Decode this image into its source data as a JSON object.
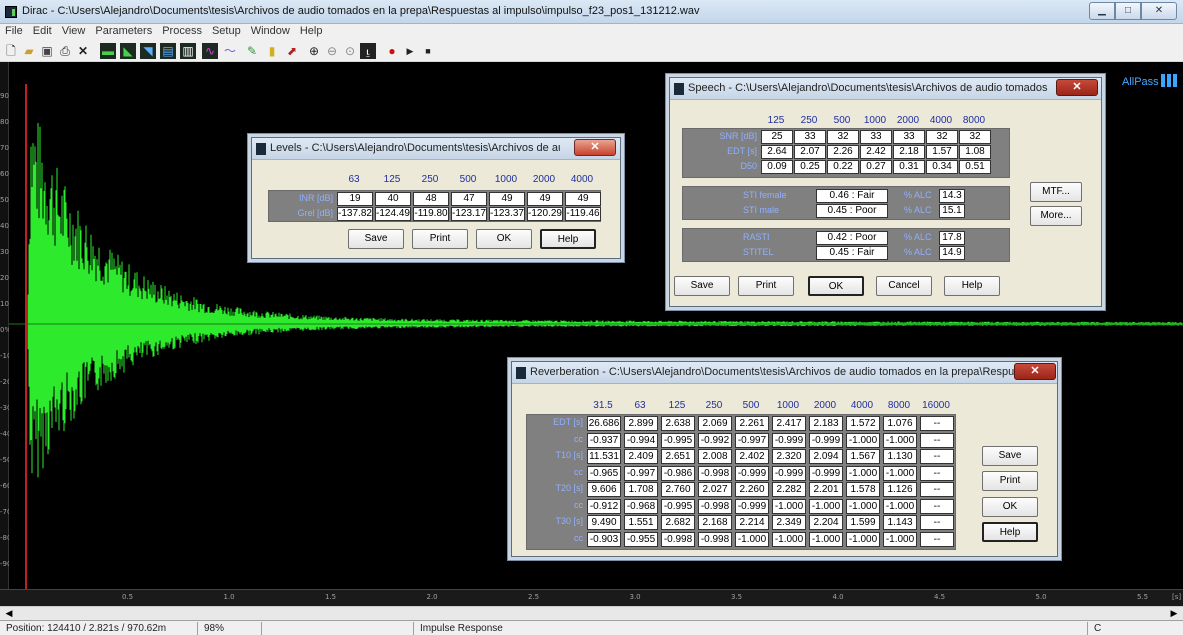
{
  "window": {
    "title": "Dirac - C:\\Users\\Alejandro\\Documents\\tesis\\Archivos de audio tomados en la prepa\\Respuestas al impulso\\impulso_f23_pos1_131212.wav",
    "btn_min": "▁",
    "btn_max": "□",
    "btn_close": "✕"
  },
  "menu": [
    "File",
    "Edit",
    "View",
    "Parameters",
    "Process",
    "Setup",
    "Window",
    "Help"
  ],
  "plot": {
    "y_ticks": [
      "90",
      "80",
      "70",
      "60",
      "50",
      "40",
      "30",
      "20",
      "10",
      "0%",
      "-10",
      "-20",
      "-30",
      "-40",
      "-50",
      "-60",
      "-70",
      "-80",
      "-90"
    ],
    "x_ticks": [
      "0.5",
      "1.0",
      "1.5",
      "2.0",
      "2.5",
      "3.0",
      "3.5",
      "4.0",
      "4.5",
      "5.0",
      "5.5"
    ],
    "x_unit": "[s]",
    "wave_color": "#2dea2d",
    "allpass": "AllPass"
  },
  "levels": {
    "title": "Levels - C:\\Users\\Alejandro\\Documents\\tesis\\Archivos de audio ...",
    "headers": [
      "63",
      "125",
      "250",
      "500",
      "1000",
      "2000",
      "4000"
    ],
    "rows": [
      {
        "label": "INR [dB]",
        "values": [
          "19",
          "40",
          "48",
          "47",
          "49",
          "49",
          "49"
        ]
      },
      {
        "label": "Grel [dB]",
        "values": [
          "-137.82",
          "-124.49",
          "-119.80",
          "-123.17",
          "-123.37",
          "-120.29",
          "-119.46"
        ]
      }
    ],
    "buttons": [
      "Save",
      "Print",
      "OK",
      "Help"
    ]
  },
  "speech": {
    "title": "Speech - C:\\Users\\Alejandro\\Documents\\tesis\\Archivos de audio tomados en l...",
    "headers": [
      "125",
      "250",
      "500",
      "1000",
      "2000",
      "4000",
      "8000"
    ],
    "rows": [
      {
        "label": "SNR [dB]",
        "values": [
          "25",
          "33",
          "32",
          "33",
          "33",
          "32",
          "32"
        ]
      },
      {
        "label": "EDT [s]",
        "values": [
          "2.64",
          "2.07",
          "2.26",
          "2.42",
          "2.18",
          "1.57",
          "1.08"
        ]
      },
      {
        "label": "D50",
        "values": [
          "0.09",
          "0.25",
          "0.22",
          "0.27",
          "0.31",
          "0.34",
          "0.51"
        ]
      }
    ],
    "sti": [
      {
        "label": "STI female",
        "value": "0.46 : Fair",
        "alc_label": "% ALC",
        "alc": "14.3"
      },
      {
        "label": "STI male",
        "value": "0.45 : Poor",
        "alc_label": "% ALC",
        "alc": "15.1"
      }
    ],
    "rasti": [
      {
        "label": "RASTI",
        "value": "0.42 : Poor",
        "alc_label": "% ALC",
        "alc": "17.8"
      },
      {
        "label": "STITEL",
        "value": "0.45 : Fair",
        "alc_label": "% ALC",
        "alc": "14.9"
      }
    ],
    "side_buttons": [
      "MTF...",
      "More..."
    ],
    "buttons": [
      "Save",
      "Print",
      "OK",
      "Cancel",
      "Help"
    ]
  },
  "reverb": {
    "title": "Reverberation - C:\\Users\\Alejandro\\Documents\\tesis\\Archivos de audio tomados en la prepa\\Respuest...",
    "headers": [
      "31.5",
      "63",
      "125",
      "250",
      "500",
      "1000",
      "2000",
      "4000",
      "8000",
      "16000"
    ],
    "rows": [
      {
        "label": "EDT [s]",
        "values": [
          "26.686",
          "2.899",
          "2.638",
          "2.069",
          "2.261",
          "2.417",
          "2.183",
          "1.572",
          "1.076",
          "--"
        ]
      },
      {
        "label": "cc",
        "values": [
          "-0.937",
          "-0.994",
          "-0.995",
          "-0.992",
          "-0.997",
          "-0.999",
          "-0.999",
          "-1.000",
          "-1.000",
          "--"
        ]
      },
      {
        "label": "T10 [s]",
        "values": [
          "11.531",
          "2.409",
          "2.651",
          "2.008",
          "2.402",
          "2.320",
          "2.094",
          "1.567",
          "1.130",
          "--"
        ]
      },
      {
        "label": "cc",
        "values": [
          "-0.965",
          "-0.997",
          "-0.986",
          "-0.998",
          "-0.999",
          "-0.999",
          "-0.999",
          "-1.000",
          "-1.000",
          "--"
        ]
      },
      {
        "label": "T20 [s]",
        "values": [
          "9.606",
          "1.708",
          "2.760",
          "2.027",
          "2.260",
          "2.282",
          "2.201",
          "1.578",
          "1.126",
          "--"
        ]
      },
      {
        "label": "cc",
        "values": [
          "-0.912",
          "-0.968",
          "-0.995",
          "-0.998",
          "-0.999",
          "-1.000",
          "-1.000",
          "-1.000",
          "-1.000",
          "--"
        ]
      },
      {
        "label": "T30 [s]",
        "values": [
          "9.490",
          "1.551",
          "2.682",
          "2.168",
          "2.214",
          "2.349",
          "2.204",
          "1.599",
          "1.143",
          "--"
        ]
      },
      {
        "label": "cc",
        "values": [
          "-0.903",
          "-0.955",
          "-0.998",
          "-0.998",
          "-1.000",
          "-1.000",
          "-1.000",
          "-1.000",
          "-1.000",
          "--"
        ]
      }
    ],
    "buttons": [
      "Save",
      "Print",
      "OK",
      "Help"
    ]
  },
  "status": {
    "position": "Position: 124410 / 2.821s / 970.62m",
    "zoom": "98%",
    "mode": "Impulse Response",
    "right": "C"
  }
}
